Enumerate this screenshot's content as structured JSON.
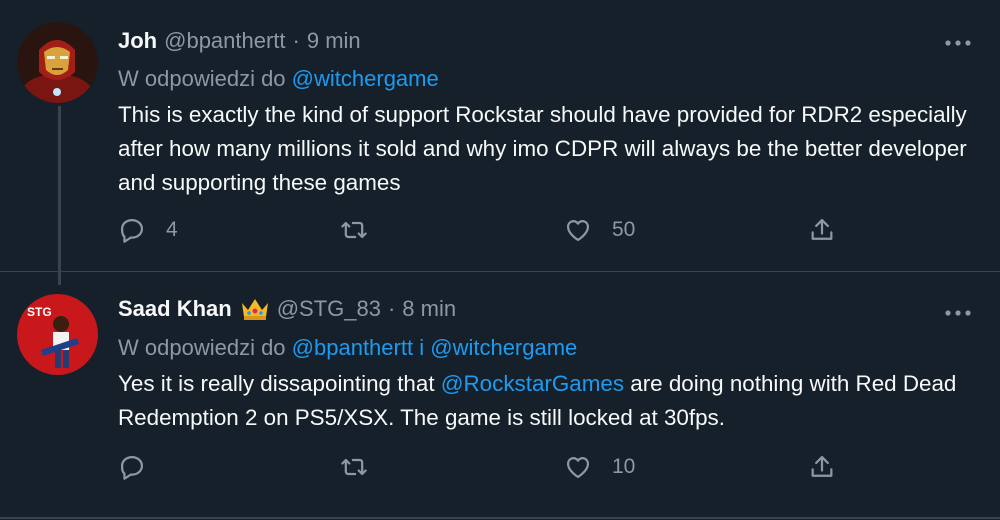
{
  "tweets": [
    {
      "name": "Joh",
      "handle": "@bpanthertt",
      "separator": "·",
      "time": "9 min",
      "reply_prefix": "W odpowiedzi do",
      "reply_to_1": "@witchergame",
      "text": "This is exactly the kind of support Rockstar should have provided for RDR2 especially after how many millions it sold and why imo CDPR will always be the better developer and supporting these games",
      "replies": "4",
      "retweets": "",
      "likes": "50",
      "avatar_icon": "iron-man-avatar"
    },
    {
      "name": "Saad Khan",
      "badge_icon": "crown-emoji",
      "handle": "@STG_83",
      "separator": "·",
      "time": "8 min",
      "reply_prefix": "W odpowiedzi do",
      "reply_to_1": "@bpanthertt",
      "reply_joiner": "i",
      "reply_to_2": "@witchergame",
      "text_part1": "Yes it is really dissapointing that ",
      "text_mention": "@RockstarGames",
      "text_part2": " are doing nothing with Red Dead Redemption 2 on PS5/XSX. The game is still locked at 30fps.",
      "replies": "",
      "retweets": "",
      "likes": "10",
      "avatar_icon": "scott-pilgrim-avatar"
    }
  ],
  "colors": {
    "background": "#15202b",
    "text": "#f7f9f9",
    "muted": "#8b98a5",
    "link": "#1d9bf0",
    "divider": "#38444d"
  }
}
